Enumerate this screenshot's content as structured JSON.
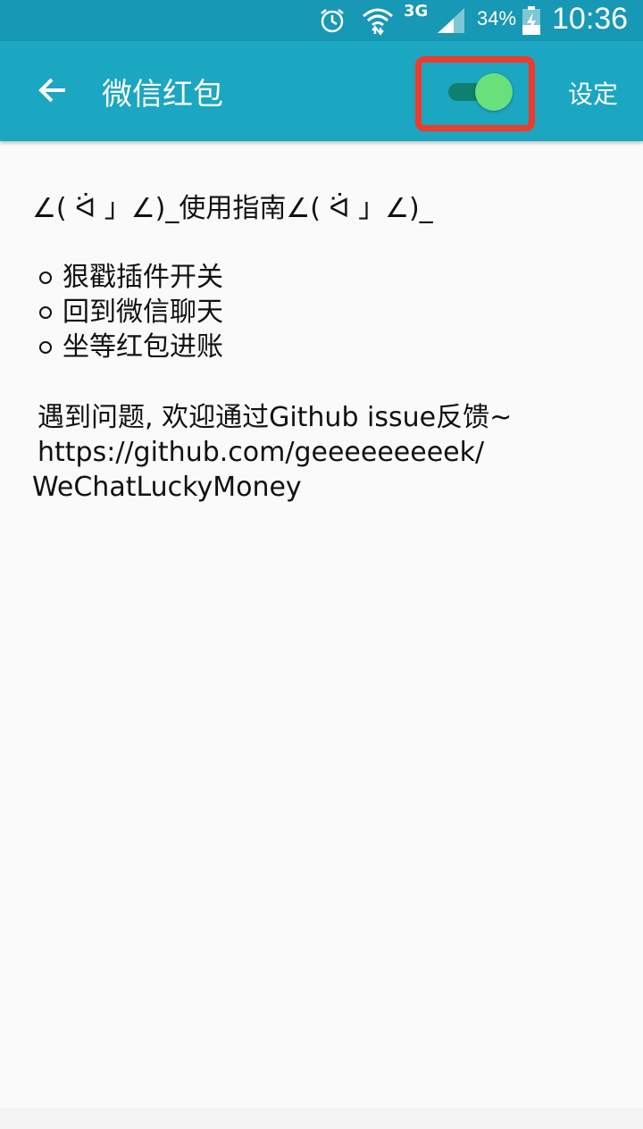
{
  "status_bar": {
    "network_type": "3G",
    "battery_percent": "34%",
    "time": "10:36",
    "icons": [
      "alarm-icon",
      "wifi-icon",
      "signal-icon",
      "battery-charging-icon"
    ]
  },
  "app_bar": {
    "back_icon": "arrow-left-icon",
    "title": "微信红包",
    "switch_state": "on",
    "settings_label": "设定",
    "colors": {
      "app_bar": "#1ba6c2",
      "status_bar": "#1798b4",
      "switch_thumb": "#69e07b",
      "switch_track": "#0f7f6e",
      "highlight": "#ef3a2c"
    }
  },
  "content": {
    "guide_title": "∠( ᐛ 」∠)_使用指南∠( ᐛ 」∠)_",
    "features": [
      {
        "label": "狠戳插件开关"
      },
      {
        "label": "回到微信聊天"
      },
      {
        "label": "坐等红包进账"
      }
    ],
    "feedback_text": "遇到问题, 欢迎通过Github issue反馈~",
    "link_line1": "https://github.com/geeeeeeeeek/",
    "link_line2": "WeChatLuckyMoney"
  }
}
